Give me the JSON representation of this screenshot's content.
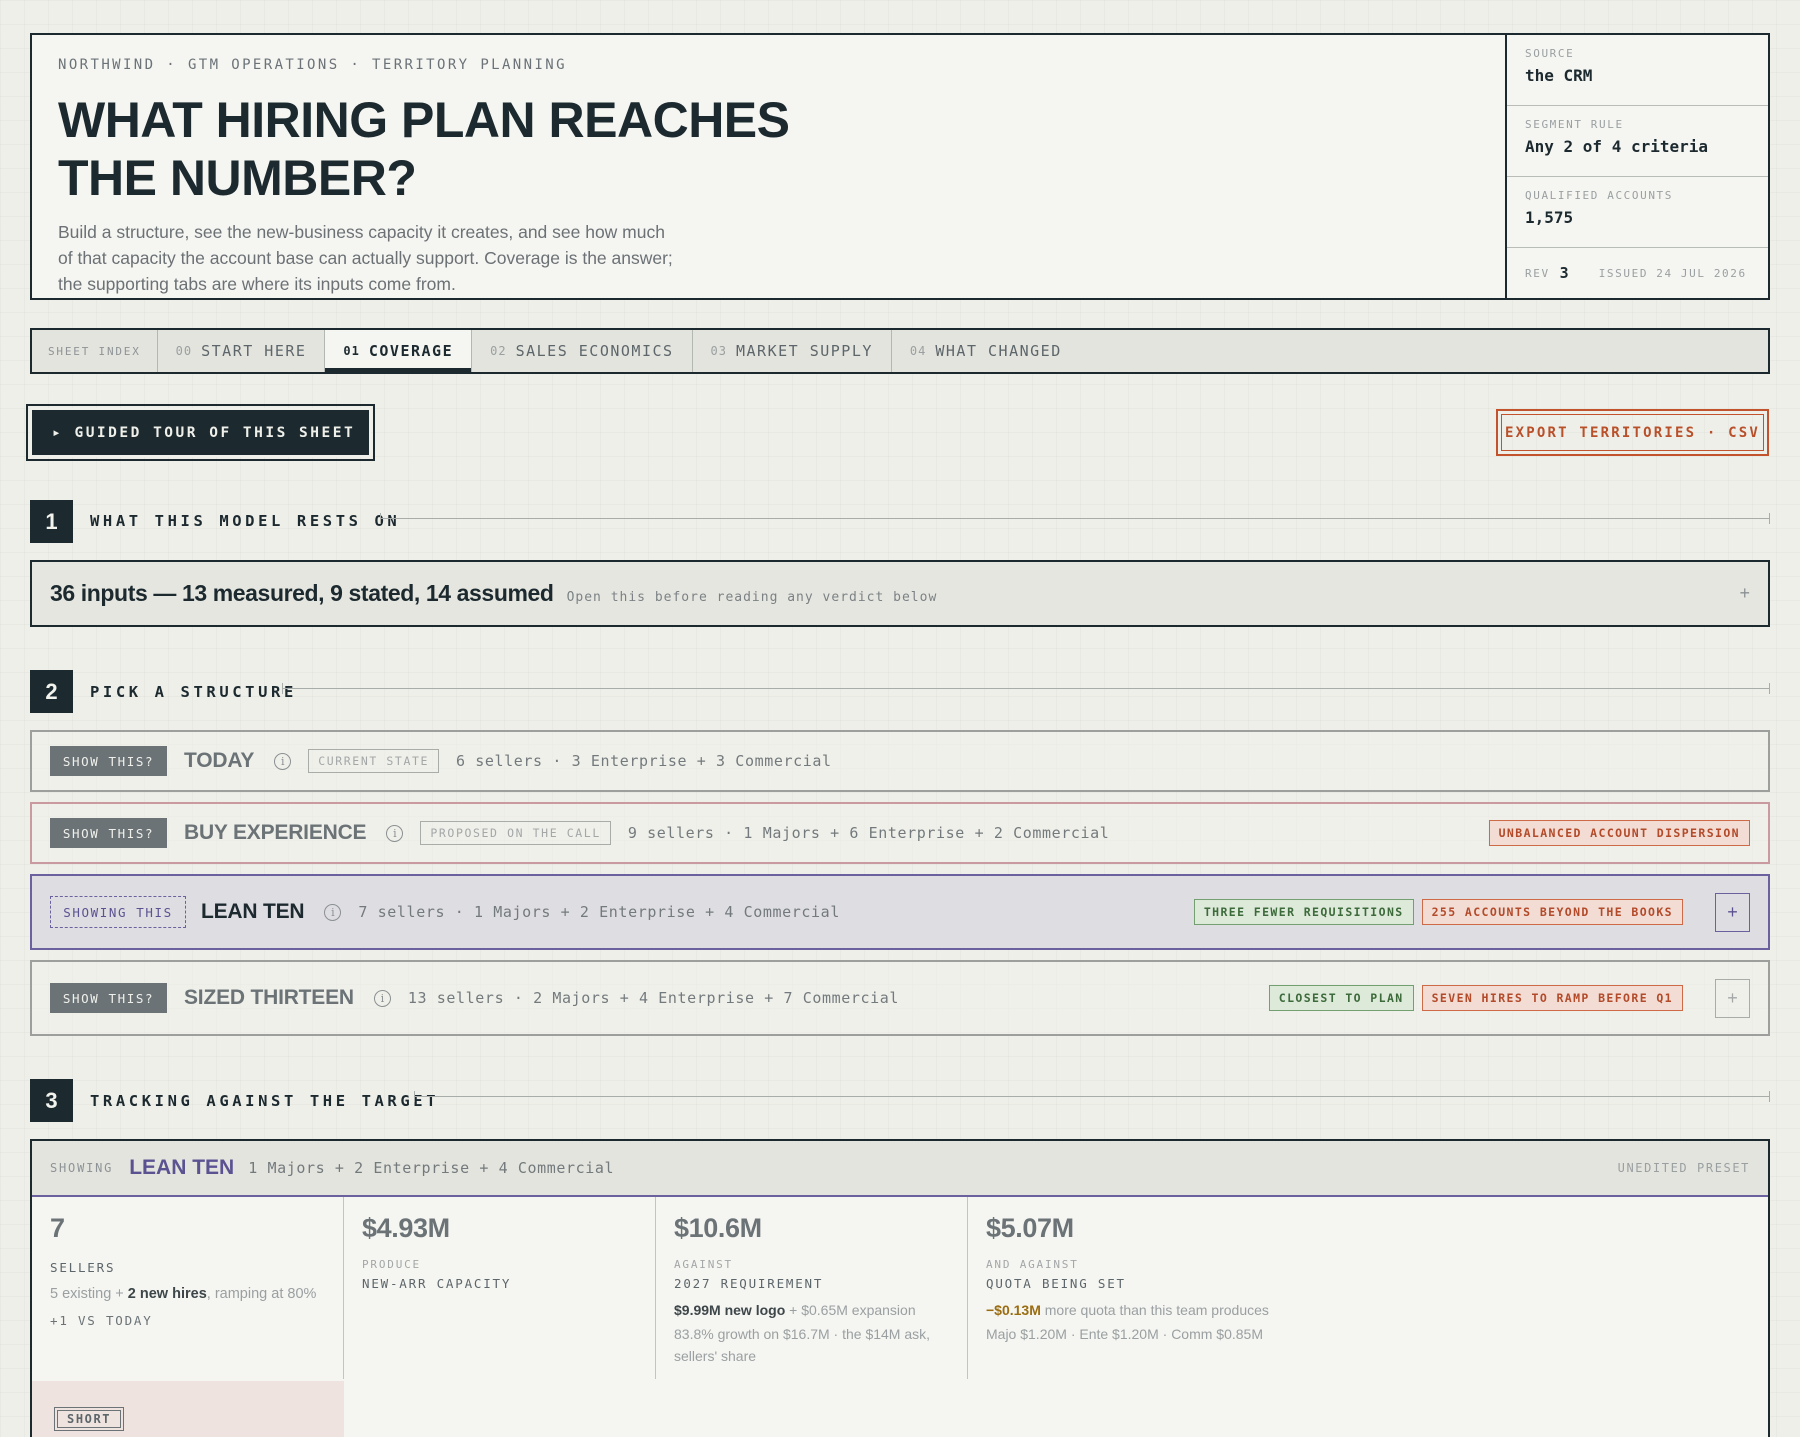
{
  "header": {
    "breadcrumb": "NORTHWIND · GTM OPERATIONS · TERRITORY PLANNING",
    "title_line1": "WHAT HIRING PLAN REACHES",
    "title_line2": "THE NUMBER?",
    "lede": "Build a structure, see the new-business capacity it creates, and see how much of that capacity the account base can actually support. Coverage is the answer; the supporting tabs are where its inputs come from.",
    "meta": {
      "source_label": "SOURCE",
      "source_value": "the CRM",
      "segment_label": "SEGMENT RULE",
      "segment_value": "Any 2 of 4 criteria",
      "qualified_label": "QUALIFIED ACCOUNTS",
      "qualified_value": "1,575",
      "rev_label": "REV",
      "rev_value": "3",
      "issued": "ISSUED 24 JUL 2026"
    }
  },
  "tabs": {
    "index_label": "SHEET INDEX",
    "items": [
      {
        "num": "00",
        "label": "START HERE"
      },
      {
        "num": "01",
        "label": "COVERAGE"
      },
      {
        "num": "02",
        "label": "SALES ECONOMICS"
      },
      {
        "num": "03",
        "label": "MARKET SUPPLY"
      },
      {
        "num": "04",
        "label": "WHAT CHANGED"
      }
    ]
  },
  "actions": {
    "tour_label": "▸ GUIDED TOUR OF THIS SHEET",
    "export_label": "EXPORT TERRITORIES · CSV"
  },
  "sections": {
    "s1": {
      "num": "1",
      "title": "WHAT THIS MODEL RESTS ON"
    },
    "s2": {
      "num": "2",
      "title": "PICK A STRUCTURE"
    },
    "s3": {
      "num": "3",
      "title": "TRACKING AGAINST THE TARGET"
    }
  },
  "inputs": {
    "summary": "36 inputs — 13 measured, 9 stated, 14 assumed",
    "hint": "Open this before reading any verdict below",
    "toggle": "+"
  },
  "structures": [
    {
      "button": "SHOW THIS?",
      "name": "TODAY",
      "tag": "CURRENT STATE",
      "desc": "6 sellers · 3 Enterprise + 3 Commercial",
      "flags": []
    },
    {
      "button": "SHOW THIS?",
      "name": "BUY EXPERIENCE",
      "tag": "PROPOSED ON THE CALL",
      "desc": "9 sellers · 1 Majors + 6 Enterprise + 2 Commercial",
      "flags": [
        "UNBALANCED ACCOUNT DISPERSION"
      ]
    },
    {
      "button": "SHOWING THIS",
      "name": "LEAN TEN",
      "desc": "7 sellers · 1 Majors + 2 Enterprise + 4 Commercial",
      "flag_green": "THREE FEWER REQUISITIONS",
      "flag_red": "255 ACCOUNTS BEYOND THE BOOKS",
      "toggle": "+"
    },
    {
      "button": "SHOW THIS?",
      "name": "SIZED THIRTEEN",
      "desc": "13 sellers · 2 Majors + 4 Enterprise + 7 Commercial",
      "flag_green": "CLOSEST TO PLAN",
      "flag_red": "SEVEN HIRES TO RAMP BEFORE Q1",
      "toggle": "+"
    }
  ],
  "tracking": {
    "showing_label": "SHOWING",
    "name": "LEAN TEN",
    "desc": "1 Majors + 2 Enterprise + 4 Commercial",
    "preset": "UNEDITED PRESET",
    "sellers": {
      "value": "7",
      "label": "SELLERS",
      "note_pre": "5 existing + ",
      "note_bold": "2 new hires",
      "note_post": ", ramping at 80%",
      "delta": "+1 VS TODAY"
    },
    "capacity": {
      "value": "$4.93M",
      "pre": "PRODUCE",
      "label": "NEW-ARR CAPACITY"
    },
    "requirement": {
      "value": "$10.6M",
      "pre": "AGAINST",
      "label": "2027 REQUIREMENT",
      "note_bold": "$9.99M new logo",
      "note_post": " + $0.65M expansion",
      "note2": "83.8% growth on $16.7M · the $14M ask, sellers' share"
    },
    "quota": {
      "value": "$5.07M",
      "pre": "AND AGAINST",
      "label": "QUOTA BEING SET",
      "note_bold": "−$0.13M",
      "note_post": " more quota than this team produces",
      "note2": "Majo $1.20M · Ente $1.20M · Comm $0.85M"
    },
    "status_tag": "SHORT"
  }
}
